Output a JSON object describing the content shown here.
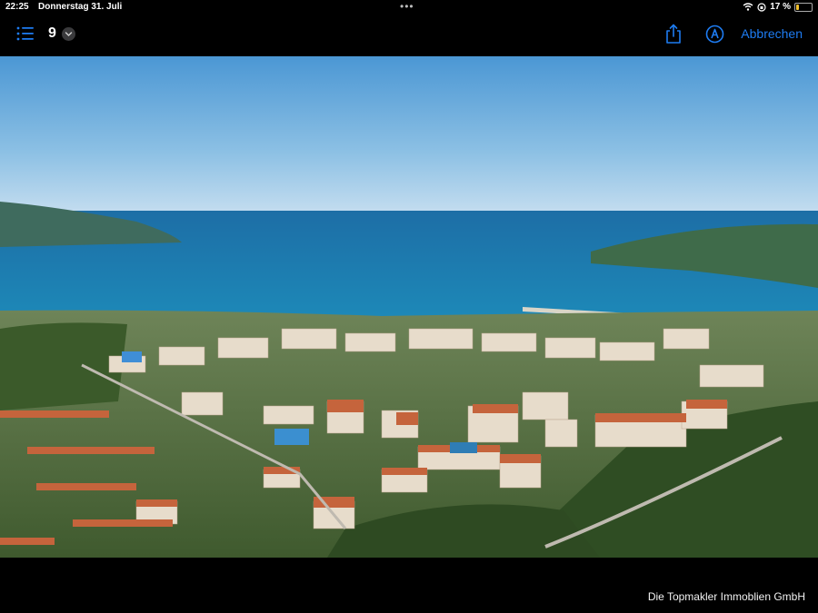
{
  "status": {
    "time": "22:25",
    "date": "Donnerstag 31. Juli",
    "dots": "•••",
    "battery_percent": "17 %",
    "battery_level": 0.17,
    "battery_color": "#f2c12e"
  },
  "toolbar": {
    "page_count": "9",
    "cancel_label": "Abbrechen",
    "accent_color": "#1e7cf2",
    "icons": [
      "list-icon",
      "chevron-down-icon",
      "share-icon",
      "markup-pen-icon"
    ]
  },
  "caption": {
    "text": "Die Topmakler Immoblien GmbH"
  }
}
